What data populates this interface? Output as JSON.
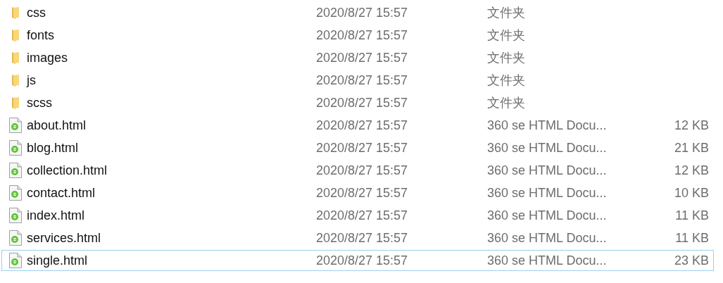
{
  "files": [
    {
      "kind": "folder",
      "name": "css",
      "date": "2020/8/27 15:57",
      "type": "文件夹",
      "focused": false
    },
    {
      "kind": "folder",
      "name": "fonts",
      "date": "2020/8/27 15:57",
      "type": "文件夹",
      "focused": false
    },
    {
      "kind": "folder",
      "name": "images",
      "date": "2020/8/27 15:57",
      "type": "文件夹",
      "focused": false
    },
    {
      "kind": "folder",
      "name": "js",
      "date": "2020/8/27 15:57",
      "type": "文件夹",
      "focused": false
    },
    {
      "kind": "folder",
      "name": "scss",
      "date": "2020/8/27 15:57",
      "type": "文件夹",
      "focused": false
    },
    {
      "kind": "html",
      "name": "about.html",
      "date": "2020/8/27 15:57",
      "type": "360 se HTML Docu...",
      "size": "12 KB",
      "focused": false
    },
    {
      "kind": "html",
      "name": "blog.html",
      "date": "2020/8/27 15:57",
      "type": "360 se HTML Docu...",
      "size": "21 KB",
      "focused": false
    },
    {
      "kind": "html",
      "name": "collection.html",
      "date": "2020/8/27 15:57",
      "type": "360 se HTML Docu...",
      "size": "12 KB",
      "focused": false
    },
    {
      "kind": "html",
      "name": "contact.html",
      "date": "2020/8/27 15:57",
      "type": "360 se HTML Docu...",
      "size": "10 KB",
      "focused": false
    },
    {
      "kind": "html",
      "name": "index.html",
      "date": "2020/8/27 15:57",
      "type": "360 se HTML Docu...",
      "size": "11 KB",
      "focused": false
    },
    {
      "kind": "html",
      "name": "services.html",
      "date": "2020/8/27 15:57",
      "type": "360 se HTML Docu...",
      "size": "11 KB",
      "focused": false
    },
    {
      "kind": "html",
      "name": "single.html",
      "date": "2020/8/27 15:57",
      "type": "360 se HTML Docu...",
      "size": "23 KB",
      "focused": true
    }
  ]
}
